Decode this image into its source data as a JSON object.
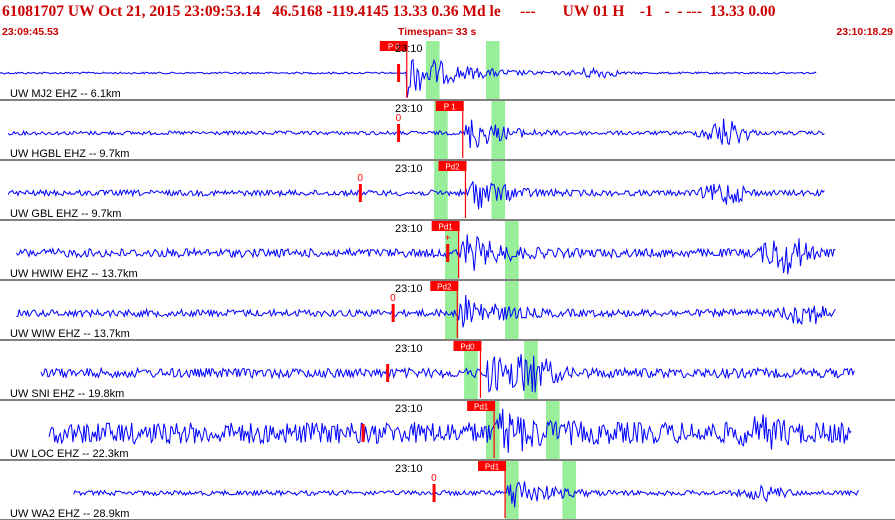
{
  "header": {
    "title": "61081707 UW Oct 21, 2015 23:09:53.14   46.5168 -119.4145 13.33 0.36 Md le     ---       UW 01 H    -1   -  - ---  13.33 0.00",
    "start_time": "23:09:45.53",
    "timespan": "Timespan=  33 s",
    "end_time": "23:10:18.29"
  },
  "colors": {
    "header_text": "#cc0000",
    "waveform": "#0000ff",
    "pick": "#ff0000",
    "window": "#99ee99",
    "separator": "#000000"
  },
  "minute_label": "23:10",
  "traces": [
    {
      "label": "UW MJ2 EHZ -- 6.1km",
      "pick": "P 0",
      "pick_time": 23.9,
      "env_type": "decay",
      "data_start": 0.0,
      "data_end": 29.9,
      "noise": 0.04,
      "amp": 1.0,
      "event2_time": 21.8,
      "event2_amp": 0.25,
      "windows": [
        [
          24.6,
          25.1
        ],
        [
          26.8,
          27.3
        ]
      ],
      "marker": {
        "time": 28.6,
        "text": ""
      }
    },
    {
      "label": "UW HGBL EHZ -- 9.7km",
      "pick": "P 1",
      "pick_time": 25.95,
      "env_type": "burst",
      "data_start": 0.3,
      "data_end": 30.2,
      "noise": 0.08,
      "amp": 1.0,
      "event2_time": 26.6,
      "event2_amp": 0.7,
      "windows": [
        [
          24.9,
          25.4
        ],
        [
          27.0,
          27.5
        ]
      ],
      "marker": {
        "time": 28.6,
        "text": "0"
      }
    },
    {
      "label": "UW GBL EHZ -- 9.7km",
      "pick": "Pd2",
      "pick_time": 26.05,
      "env_type": "burst",
      "data_start": 0.3,
      "data_end": 30.2,
      "noise": 0.12,
      "amp": 1.0,
      "event2_time": 26.6,
      "event2_amp": 0.5,
      "windows": [
        [
          24.9,
          25.4
        ],
        [
          27.0,
          27.5
        ]
      ],
      "marker": {
        "time": 27.2,
        "text": "0"
      }
    },
    {
      "label": "UW HWIW EHZ -- 13.7km",
      "pick": "Pd1",
      "pick_time": 25.8,
      "env_type": "burst",
      "data_start": 0.6,
      "data_end": 30.6,
      "noise": 0.18,
      "amp": 1.0,
      "event2_time": 28.8,
      "event2_amp": 0.9,
      "windows": [
        [
          25.3,
          25.8
        ],
        [
          27.5,
          28.0
        ]
      ],
      "marker": {
        "time": 30.4,
        "text": "+"
      }
    },
    {
      "label": "UW WIW EHZ -- 13.7km",
      "pick": "Pd2",
      "pick_time": 25.75,
      "env_type": "burst",
      "data_start": 0.6,
      "data_end": 30.6,
      "noise": 0.15,
      "amp": 1.0,
      "event2_time": 29.5,
      "event2_amp": 0.5,
      "windows": [
        [
          25.3,
          25.8
        ],
        [
          27.5,
          28.0
        ]
      ],
      "marker": {
        "time": 28.4,
        "text": "0"
      }
    },
    {
      "label": "UW SNI EHZ -- 19.8km",
      "pick": "Pd0",
      "pick_time": 26.6,
      "env_type": "burst",
      "data_start": 1.5,
      "data_end": 31.3,
      "noise": 0.2,
      "amp": 1.0,
      "event2_time": 19.5,
      "event2_amp": 0.7,
      "windows": [
        [
          26.0,
          26.5
        ],
        [
          28.2,
          28.7
        ]
      ],
      "marker": {
        "time": 28.2,
        "text": ""
      }
    },
    {
      "label": "UW LOC EHZ -- 22.3km",
      "pick": "Pd1",
      "pick_time": 27.1,
      "env_type": "burst",
      "data_start": 1.8,
      "data_end": 31.2,
      "noise": 0.45,
      "amp": 1.0,
      "event2_time": 28.0,
      "event2_amp": 0.4,
      "windows": [
        [
          26.8,
          27.3
        ],
        [
          29.0,
          29.5
        ]
      ],
      "marker": {
        "time": 27.3,
        "text": ""
      }
    },
    {
      "label": "UW WA2 EHZ -- 28.9km",
      "pick": "Pd1",
      "pick_time": 27.5,
      "env_type": "burst",
      "data_start": 2.7,
      "data_end": 31.5,
      "noise": 0.1,
      "amp": 1.0,
      "event2_time": 28.0,
      "event2_amp": 0.3,
      "windows": [
        [
          27.5,
          28.0
        ],
        [
          29.6,
          30.1
        ]
      ],
      "marker": {
        "time": 29.9,
        "text": "0"
      }
    }
  ]
}
